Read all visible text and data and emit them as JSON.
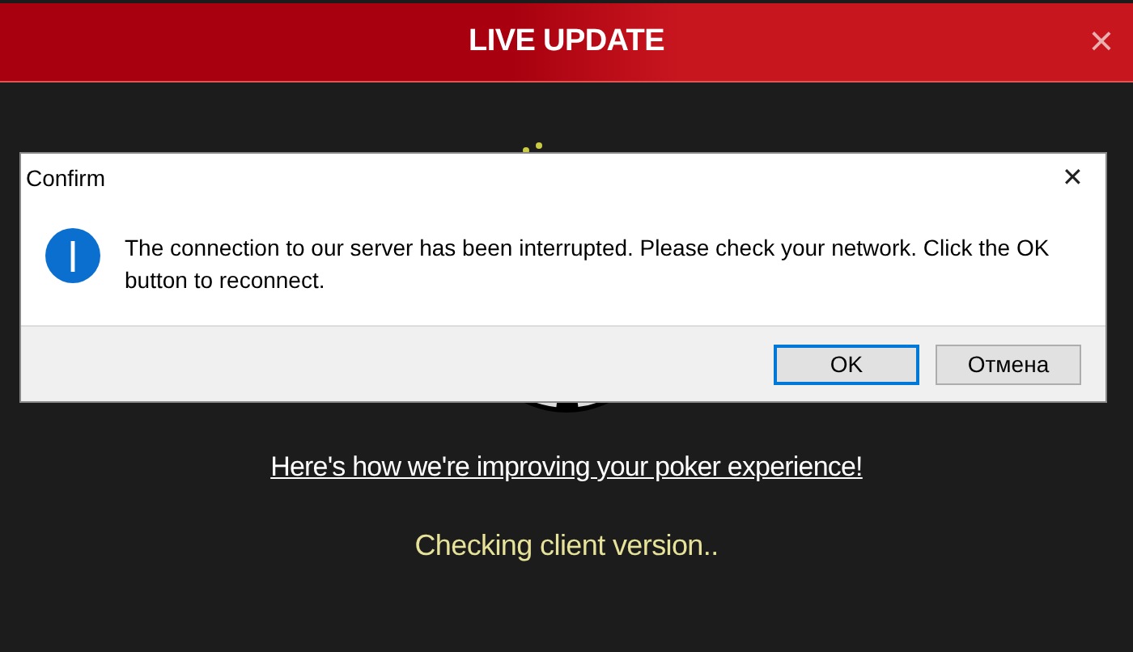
{
  "window": {
    "title": "LIVE UPDATE",
    "close": "×"
  },
  "main": {
    "link": "Here's how we're improving your poker experience!",
    "status": "Checking client version.."
  },
  "dialog": {
    "title": "Confirm",
    "close": "✕",
    "message": "The connection to our server has been interrupted. Please check your network. Click the OK button to reconnect.",
    "buttons": [
      {
        "label": "OK",
        "focused": true
      },
      {
        "label": "Отмена",
        "focused": false
      }
    ]
  }
}
